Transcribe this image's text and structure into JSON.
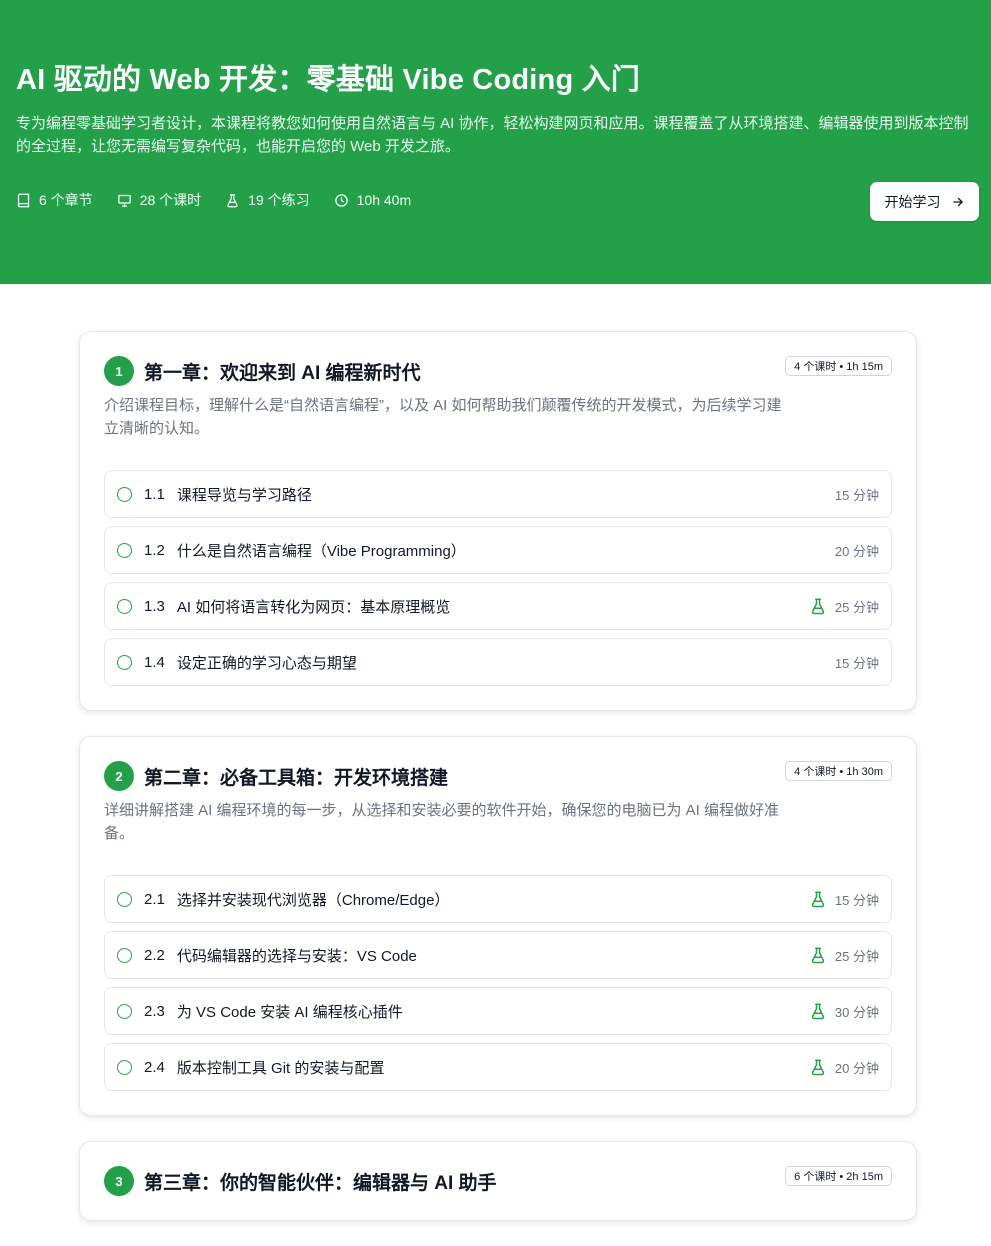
{
  "hero": {
    "title": "AI 驱动的 Web 开发：零基础 Vibe Coding 入门",
    "description": "专为编程零基础学习者设计，本课程将教您如何使用自然语言与 AI 协作，轻松构建网页和应用。课程覆盖了从环境搭建、编辑器使用到版本控制的全过程，让您无需编写复杂代码，也能开启您的 Web 开发之旅。",
    "stats": {
      "chapters": "6 个章节",
      "lessons": "28 个课时",
      "exercises": "19 个练习",
      "duration": "10h 40m"
    },
    "start_label": "开始学习",
    "accent_color": "#22a149"
  },
  "chapters": [
    {
      "number": "1",
      "title": "第一章：欢迎来到 AI 编程新时代",
      "badge": "4 个课时 • 1h 15m",
      "description": "介绍课程目标，理解什么是“自然语言编程”，以及 AI 如何帮助我们颠覆传统的开发模式，为后续学习建立清晰的认知。",
      "lessons": [
        {
          "num": "1.1",
          "title": "课程导览与学习路径",
          "duration": "15 分钟",
          "exercise": false
        },
        {
          "num": "1.2",
          "title": "什么是自然语言编程（Vibe Programming）",
          "duration": "20 分钟",
          "exercise": false
        },
        {
          "num": "1.3",
          "title": "AI 如何将语言转化为网页：基本原理概览",
          "duration": "25 分钟",
          "exercise": true
        },
        {
          "num": "1.4",
          "title": "设定正确的学习心态与期望",
          "duration": "15 分钟",
          "exercise": false
        }
      ]
    },
    {
      "number": "2",
      "title": "第二章：必备工具箱：开发环境搭建",
      "badge": "4 个课时 • 1h 30m",
      "description": "详细讲解搭建 AI 编程环境的每一步，从选择和安装必要的软件开始，确保您的电脑已为 AI 编程做好准备。",
      "lessons": [
        {
          "num": "2.1",
          "title": "选择并安装现代浏览器（Chrome/Edge）",
          "duration": "15 分钟",
          "exercise": true
        },
        {
          "num": "2.2",
          "title": "代码编辑器的选择与安装：VS Code",
          "duration": "25 分钟",
          "exercise": true
        },
        {
          "num": "2.3",
          "title": "为 VS Code 安装 AI 编程核心插件",
          "duration": "30 分钟",
          "exercise": true
        },
        {
          "num": "2.4",
          "title": "版本控制工具 Git 的安装与配置",
          "duration": "20 分钟",
          "exercise": true
        }
      ]
    },
    {
      "number": "3",
      "title": "第三章：你的智能伙伴：编辑器与 AI 助手",
      "badge": "6 个课时 • 2h 15m",
      "description": "",
      "lessons": []
    }
  ]
}
